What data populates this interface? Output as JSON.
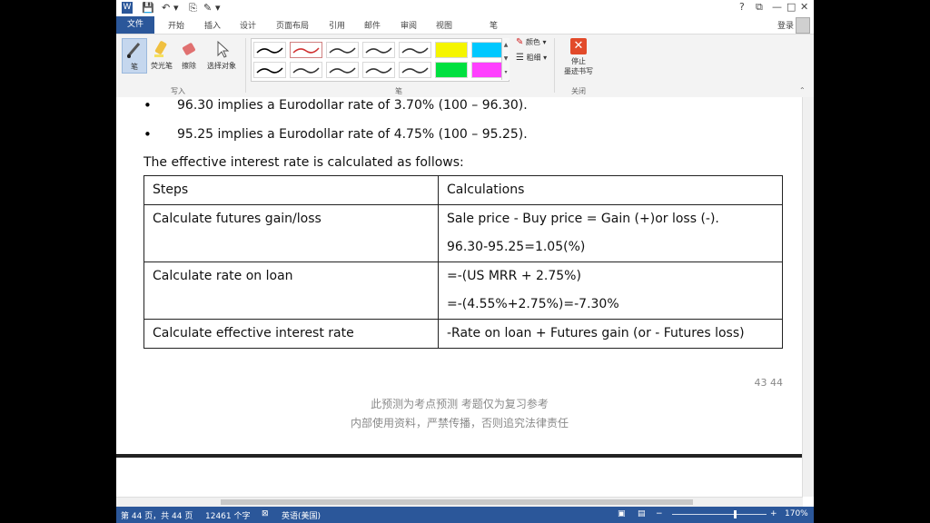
{
  "titlebar": {
    "quick_access": [
      "W",
      "💾",
      "↶",
      "▾",
      "⎘",
      "✎",
      "▾"
    ],
    "window_controls": [
      "?",
      "⧉",
      "—",
      "□",
      "✕"
    ]
  },
  "tabs": {
    "file": "文件",
    "items": [
      "开始",
      "插入",
      "设计",
      "页面布局",
      "引用",
      "邮件",
      "审阅",
      "视图",
      "笔"
    ],
    "login": "登录"
  },
  "ribbon": {
    "write_group": {
      "label": "写入",
      "buttons": [
        "笔",
        "荧光笔",
        "擦除",
        "选择对象"
      ]
    },
    "pens_group": {
      "label": "笔",
      "color_label": "颜色",
      "thickness_label": "粗细"
    },
    "close_group": {
      "label": "关闭",
      "stop_label_1": "停止",
      "stop_label_2": "墨迹书写"
    }
  },
  "document": {
    "bullets": [
      "96.30 implies a Eurodollar rate of 3.70% (100 – 96.30).",
      "95.25 implies a Eurodollar rate of 4.75% (100 – 95.25)."
    ],
    "intro": "The effective interest rate is calculated as follows:",
    "table": {
      "headers": [
        "Steps",
        "Calculations"
      ],
      "rows": [
        {
          "step": "Calculate futures gain/loss",
          "calc": [
            "Sale price - Buy price = Gain (+)or loss (-).",
            "96.30-95.25=1.05(%)"
          ]
        },
        {
          "step": "Calculate rate on loan",
          "calc": [
            "=-(US MRR + 2.75%)",
            "=-(4.55%+2.75%)=-7.30%"
          ]
        },
        {
          "step": "Calculate effective interest rate",
          "calc": [
            "-Rate on loan + Futures gain (or - Futures loss)"
          ]
        }
      ]
    },
    "page_number": "43 44",
    "watermark_line1": "此预测为考点预测    考题仅为复习参考",
    "watermark_line2": "内部使用资料，严禁传播，否则追究法律责任"
  },
  "statusbar": {
    "page": "第 44 页，共 44 页",
    "words": "12461 个字",
    "language": "英语(美国)",
    "zoom": "170%"
  },
  "colors": {
    "accent": "#2b579a",
    "pen_colors": [
      "#000000",
      "#d03030",
      "#333333",
      "#333333",
      "#333333",
      "#f5f500",
      "#00c8ff",
      "#000000",
      "#333333",
      "#333333",
      "#333333",
      "#333333",
      "#00e040",
      "#ff40ff"
    ]
  }
}
